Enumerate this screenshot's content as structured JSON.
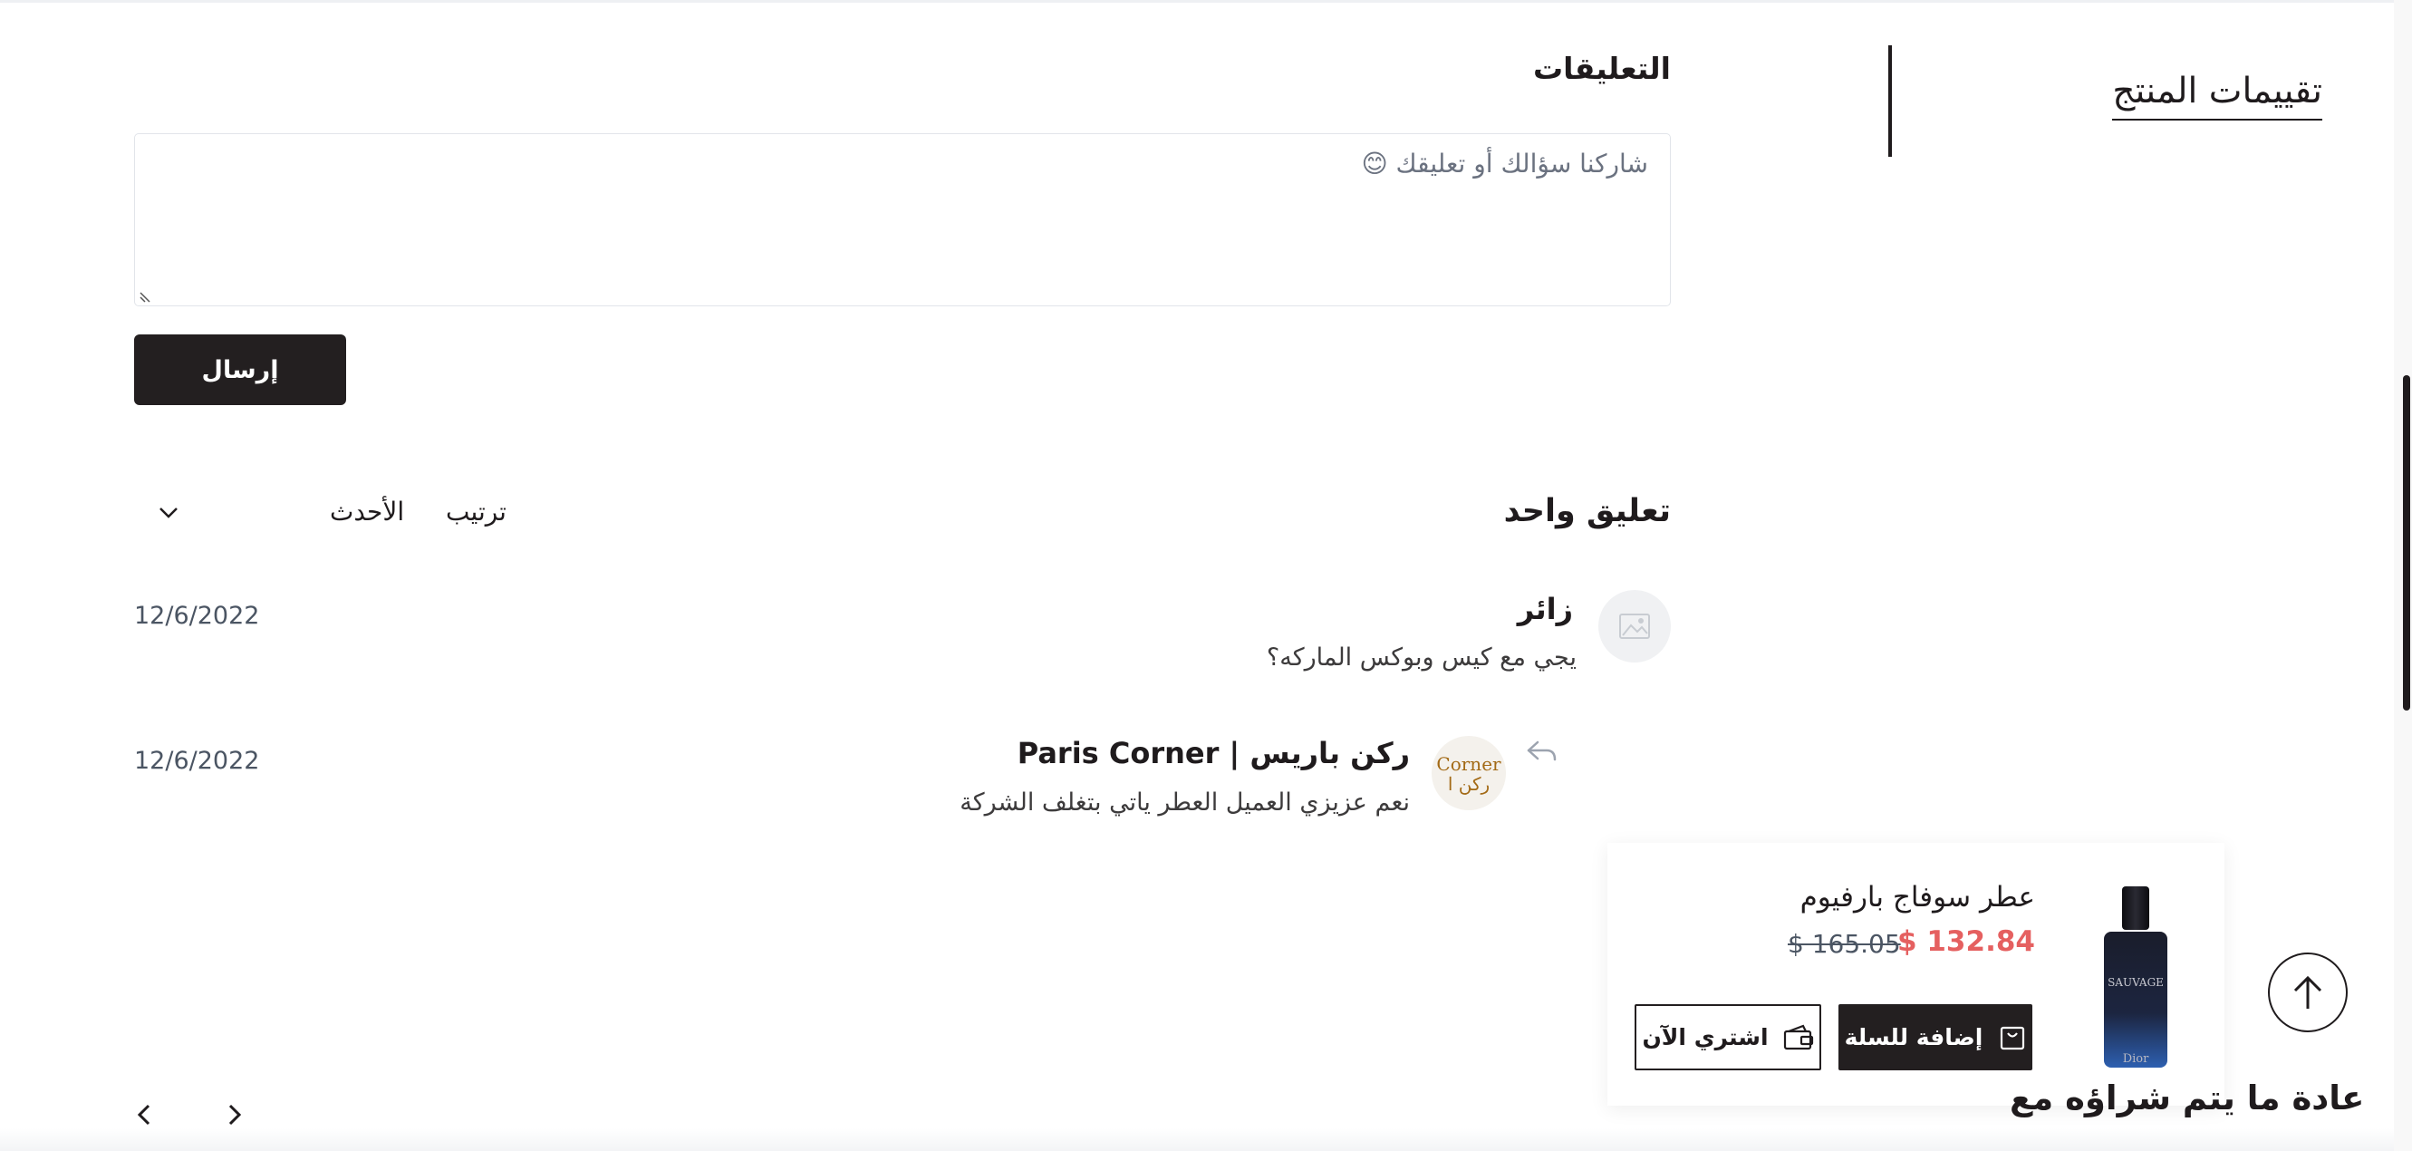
{
  "reviews_tab": {
    "title": "تقييمات المنتج"
  },
  "comments": {
    "title": "التعليقات",
    "input_placeholder": "شاركنا سؤالك أو تعليقك 😊",
    "send_label": "إرسال",
    "count_label": "تعليق واحد",
    "sort_label": "ترتيب",
    "sort_value": "الأحدث",
    "items": [
      {
        "author": "زائر",
        "text": "يجي مع كيس وبوكس الماركه؟",
        "date": "12/6/2022",
        "avatar": "image-placeholder-icon"
      },
      {
        "author": "ركن باريس | Paris Corner",
        "text": "نعم عزيزي العميل العطر ياتي بتغلف الشركة",
        "date": "12/6/2022",
        "avatar": "store-logo",
        "avatar_text": "Corner ركن ا"
      }
    ]
  },
  "cart_card": {
    "product_name": "عطر سوفاج بارفيوم",
    "price": "$ 132.84",
    "old_price": "$ 165.05",
    "add_to_cart_label": "إضافة للسلة",
    "buy_now_label": "اشتري الآن",
    "product_label": "SAUVAGE",
    "product_brand": "Dior"
  },
  "bottom_section": {
    "title": "عادة ما يتم شراؤه مع"
  },
  "colors": {
    "primary": "#231f20",
    "price": "#e56060",
    "border": "#e2e5ea"
  }
}
